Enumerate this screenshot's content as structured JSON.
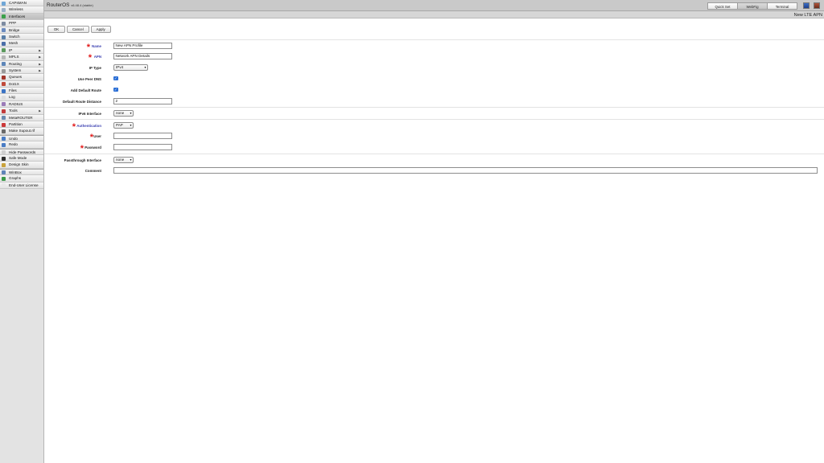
{
  "sidebar": {
    "items": [
      {
        "label": "CAPsMAN",
        "icon": "capsman-icon",
        "color": "#6fa6d6"
      },
      {
        "label": "Wireless",
        "icon": "wireless-icon",
        "color": "#9ab0c6"
      },
      {
        "label": "Interfaces",
        "icon": "interfaces-icon",
        "color": "#3aa04a",
        "active": true
      },
      {
        "label": "PPP",
        "icon": "ppp-icon",
        "color": "#7d8ba0"
      },
      {
        "label": "Bridge",
        "icon": "bridge-icon",
        "color": "#6c8bbf"
      },
      {
        "label": "Switch",
        "icon": "switch-icon",
        "color": "#5a7fa8"
      },
      {
        "label": "Mesh",
        "icon": "mesh-icon",
        "color": "#4b6ea8"
      },
      {
        "label": "IP",
        "icon": "ip-icon",
        "color": "#5c9a5e",
        "submenu": true
      },
      {
        "label": "MPLS",
        "icon": "mpls-icon",
        "color": "#b7b7b7",
        "submenu": true
      },
      {
        "label": "Routing",
        "icon": "routing-icon",
        "color": "#5e86b8",
        "submenu": true
      },
      {
        "label": "System",
        "icon": "system-icon",
        "color": "#9a9a9a",
        "submenu": true
      },
      {
        "label": "Queues",
        "icon": "queues-icon",
        "color": "#a3362c"
      },
      {
        "label": "Dot1X",
        "icon": "dot1x-icon",
        "color": "#c04a3a"
      },
      {
        "label": "Files",
        "icon": "files-icon",
        "color": "#3c74c4"
      },
      {
        "label": "Log",
        "icon": "log-icon",
        "color": "#dedede"
      },
      {
        "label": "RADIUS",
        "icon": "radius-icon",
        "color": "#9b7bb8"
      },
      {
        "label": "Tools",
        "icon": "tools-icon",
        "color": "#c23d3d",
        "submenu": true
      },
      {
        "label": "MetaROUTER",
        "icon": "metarouter-icon",
        "color": "#6a8ab0"
      },
      {
        "label": "Partition",
        "icon": "partition-icon",
        "color": "#cc3a3a"
      },
      {
        "label": "Make Supout.rif",
        "icon": "supout-icon",
        "color": "#6a6a6a"
      },
      {
        "label": "Undo",
        "icon": "undo-icon",
        "color": "#4a7cc4",
        "separator": true
      },
      {
        "label": "Redo",
        "icon": "redo-icon",
        "color": "#4a7cc4"
      },
      {
        "label": "Hide Passwords",
        "icon": "hide-passwords-icon",
        "color": "#cfcfcf",
        "separator": true
      },
      {
        "label": "Safe Mode",
        "icon": "safe-mode-icon",
        "color": "#2e2e2e"
      },
      {
        "label": "Design Skin",
        "icon": "design-skin-icon",
        "color": "#c9a23c"
      },
      {
        "label": "WinBox",
        "icon": "winbox-icon",
        "color": "#5f84b8",
        "separator": true
      },
      {
        "label": "Graphs",
        "icon": "graphs-icon",
        "color": "#3c9a4a"
      },
      {
        "label": "End-User License",
        "icon": "license-icon",
        "color": "#e8e8e8"
      }
    ]
  },
  "header": {
    "product": "RouterOS",
    "version": "v6.48.4 (stable)",
    "tabs": [
      {
        "label": "Quick Set",
        "active": false
      },
      {
        "label": "WebFig",
        "active": true
      },
      {
        "label": "Terminal",
        "active": false
      }
    ],
    "icons": [
      "save-icon",
      "winbox-download-icon"
    ]
  },
  "page": {
    "title": "New LTE APN"
  },
  "toolbar": {
    "ok": "OK",
    "cancel": "Cancel",
    "apply": "Apply"
  },
  "form": {
    "name": {
      "label": "Name",
      "value": "New APN Profile"
    },
    "apn": {
      "label": "APN",
      "value": "Network APN Details"
    },
    "ip_type": {
      "label": "IP Type",
      "value": "IPv4"
    },
    "use_peer_dns": {
      "label": "Use Peer DNS",
      "checked": true
    },
    "add_default_route": {
      "label": "Add Default Route",
      "checked": true
    },
    "default_route_distance": {
      "label": "Default Route Distance",
      "value": "2"
    },
    "ipv6_interface": {
      "label": "IPv6 Interface",
      "value": "none"
    },
    "authentication": {
      "label": "Authentication",
      "value": "PAP"
    },
    "user": {
      "label": "User",
      "value": ""
    },
    "password": {
      "label": "Password",
      "value": ""
    },
    "passthrough_interface": {
      "label": "Passthrough Interface",
      "value": "none"
    },
    "comment": {
      "label": "Comment",
      "value": ""
    }
  },
  "colors": {
    "required_star": "#e11a1a",
    "required_label": "#3a3fb0",
    "checkbox": "#2b6fd6"
  }
}
